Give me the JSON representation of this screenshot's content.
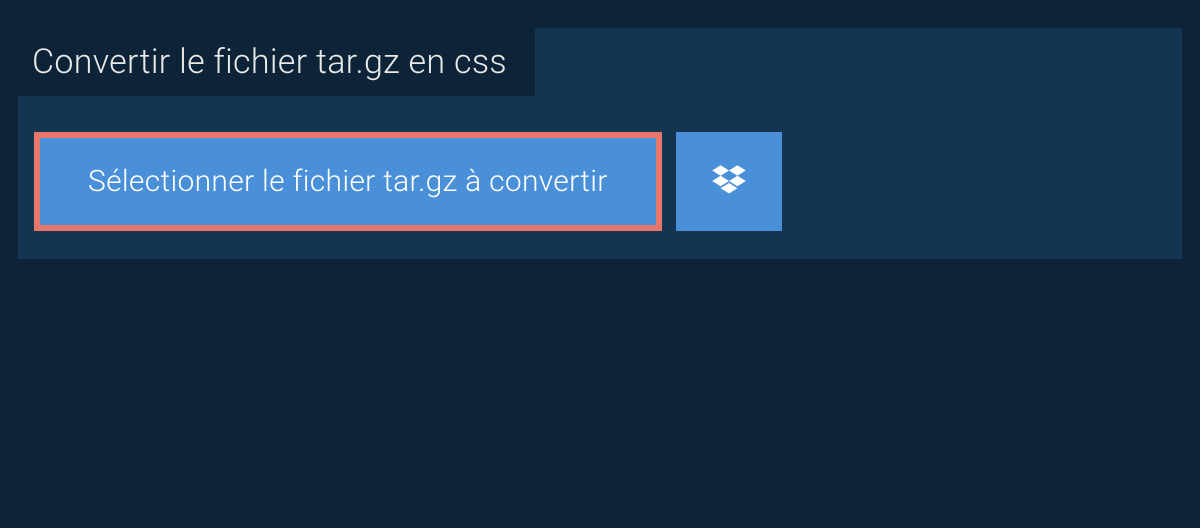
{
  "header": {
    "title": "Convertir le fichier tar.gz en css"
  },
  "actions": {
    "select_label": "Sélectionner le fichier tar.gz à convertir",
    "dropbox_icon": "dropbox-icon"
  },
  "colors": {
    "page_bg": "#0d2438",
    "panel_bg": "#143452",
    "button_bg": "#4a90d9",
    "highlight_border": "#e8766b",
    "text_light": "#e8e8e8",
    "text_white": "#ffffff"
  }
}
